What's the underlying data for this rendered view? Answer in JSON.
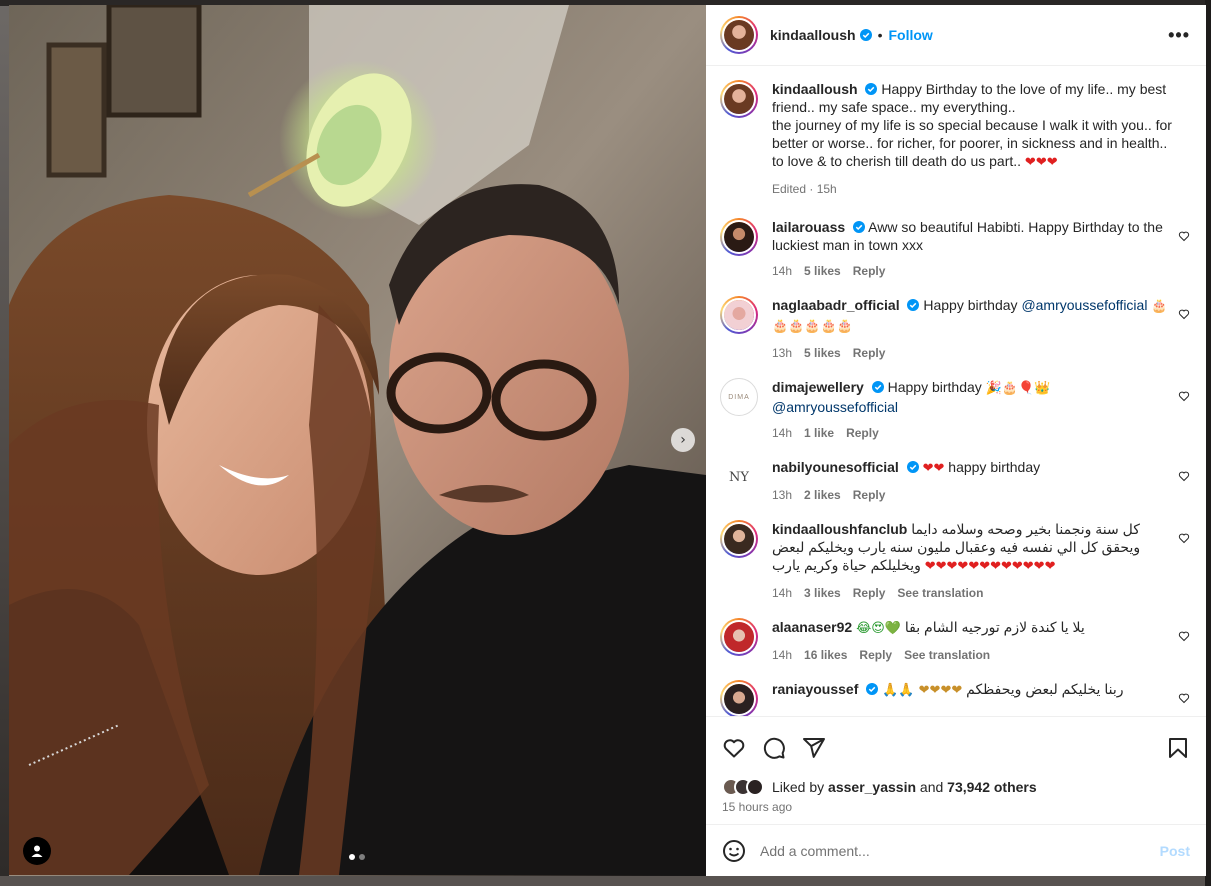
{
  "post": {
    "author": "kindaalloush",
    "follow_label": "Follow",
    "separator": "•",
    "more_icon": "more-horizontal-icon",
    "caption": {
      "line1": "Happy Birthday to the love of my life.. my best friend.. my safe space.. my everything..",
      "line2": "the journey of my life is so special because I walk it with you.. for better or worse.. for richer, for poorer, in sickness and in health.. to love & to cherish till death do us part..",
      "emoji": "❤❤❤",
      "edited": "Edited · 15h"
    },
    "media": {
      "next_icon": "chevron-right-icon",
      "tag_icon": "user-tag-icon",
      "slide_count": 2,
      "active_slide": 1
    }
  },
  "comments": [
    {
      "user": "lailarouass",
      "verified": true,
      "text": "Aww so beautiful Habibti. Happy Birthday to the luckiest man in town xxx",
      "time": "14h",
      "likes": "5 likes",
      "reply": "Reply",
      "translate": ""
    },
    {
      "user": "naglaabadr_official",
      "verified": true,
      "text": "Happy birthday",
      "mention": "@amryoussefofficial",
      "emoji": "🎂 🎂🎂🎂🎂🎂",
      "time": "13h",
      "likes": "5 likes",
      "reply": "Reply",
      "translate": ""
    },
    {
      "user": "dimajewellery",
      "verified": true,
      "text": "Happy birthday",
      "emoji": "🎉🎂🎈👑",
      "mention": "@amryoussefofficial",
      "time": "14h",
      "likes": "1 like",
      "reply": "Reply",
      "translate": ""
    },
    {
      "user": "nabilyounesofficial",
      "verified": true,
      "emoji": "❤❤",
      "text": "happy birthday",
      "time": "13h",
      "likes": "2 likes",
      "reply": "Reply",
      "translate": ""
    },
    {
      "user": "kindaalloushfanclub",
      "verified": false,
      "text": "كل سنة ونجمنا بخير وصحه وسلامه دايما ويحقق كل الي نفسه فيه وعقبال مليون سنه يارب ويخليكم لبعض ويخليلكم حياة وكريم يارب",
      "emoji": "❤❤❤❤❤❤❤❤❤❤❤❤",
      "time": "14h",
      "likes": "3 likes",
      "reply": "Reply",
      "translate": "See translation"
    },
    {
      "user": "alaanaser92",
      "verified": false,
      "text": "يلا يا كندة لازم تورجيه الشام بقا",
      "emoji": "😂😍💚",
      "time": "14h",
      "likes": "16 likes",
      "reply": "Reply",
      "translate": "See translation"
    },
    {
      "user": "raniayoussef",
      "verified": true,
      "text": "ربنا يخليكم لبعض ويحفظكم",
      "emoji": "🙏🙏 ❤❤❤❤",
      "time": "",
      "likes": "",
      "reply": "",
      "translate": ""
    }
  ],
  "actions": {
    "like_icon": "heart-icon",
    "comment_icon": "comment-icon",
    "share_icon": "share-icon",
    "save_icon": "bookmark-icon"
  },
  "likes": {
    "prefix": "Liked by",
    "user": "asser_yassin",
    "and": "and",
    "count": "73,942 others",
    "time": "15 hours ago"
  },
  "add_comment": {
    "emoji_icon": "emoji-icon",
    "placeholder": "Add a comment...",
    "post_label": "Post"
  }
}
